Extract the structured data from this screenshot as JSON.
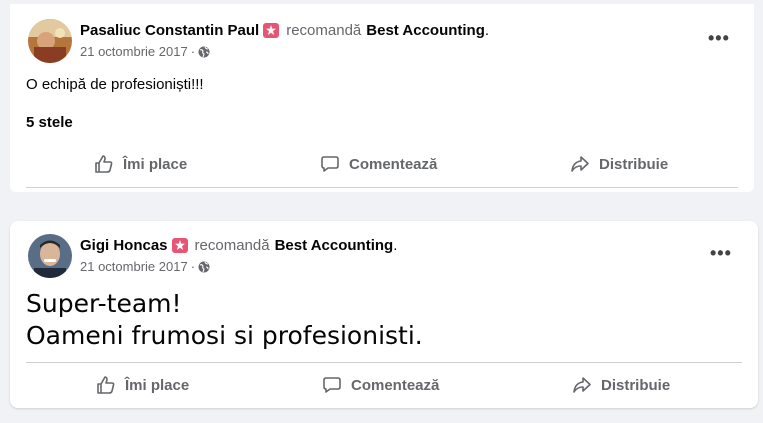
{
  "posts": [
    {
      "author": "Pasaliuc Constantin Paul",
      "verb": "recomandă",
      "page": "Best Accounting",
      "date": "21 octombrie 2017",
      "text": "O echipă de  profesioniști!!!",
      "rating": "5 stele",
      "actions": {
        "like": "Îmi place",
        "comment": "Comentează",
        "share": "Distribuie"
      }
    },
    {
      "author": "Gigi Honcas",
      "verb": "recomandă",
      "page": "Best Accounting",
      "date": "21 octombrie 2017",
      "text_line1": "Super-team!",
      "text_line2": "Oameni frumosi si profesionisti.",
      "actions": {
        "like": "Îmi place",
        "comment": "Comentează",
        "share": "Distribuie"
      }
    }
  ],
  "icons": {
    "recommend": "recommend-star-icon",
    "privacy": "globe-icon",
    "menu": "more-options-icon",
    "like": "thumbs-up-icon",
    "comment": "comment-icon",
    "share": "share-icon"
  },
  "colors": {
    "badge": "#e75574",
    "secondary_text": "#65676b",
    "divider": "#ced0d4",
    "background": "#f0f2f5"
  }
}
